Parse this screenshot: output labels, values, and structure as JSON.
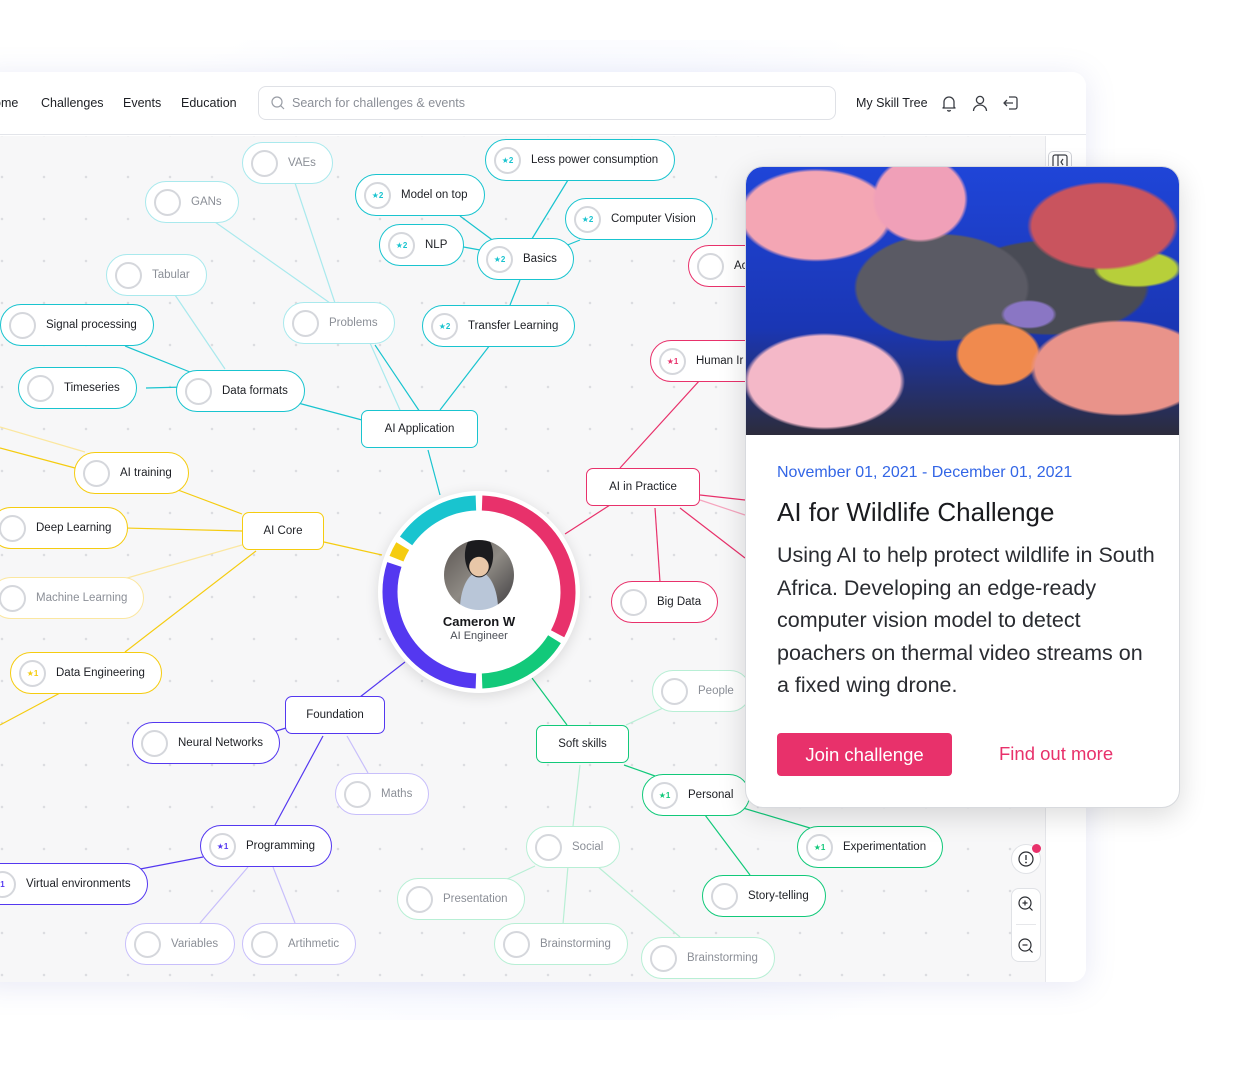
{
  "nav": {
    "items": [
      "ome",
      "Challenges",
      "Events",
      "Education"
    ],
    "search_placeholder": "Search for challenges & events",
    "skill_tree_label": "My Skill Tree",
    "icons": [
      "bell-icon",
      "user-icon",
      "logout-icon"
    ]
  },
  "colors": {
    "cyan": "#19c4cf",
    "pink": "#e8316b",
    "yellow": "#f5cc10",
    "purple": "#5438f0",
    "green": "#12c97a",
    "accent_blue": "#3366e6"
  },
  "profile": {
    "name": "Cameron W",
    "role": "AI Engineer",
    "ring_segments": [
      {
        "category": "AI Application",
        "color": "#19c4cf"
      },
      {
        "category": "AI in Practice",
        "color": "#e8316b"
      },
      {
        "category": "Soft skills",
        "color": "#12c97a"
      },
      {
        "category": "Foundation",
        "color": "#5438f0"
      },
      {
        "category": "AI Core",
        "color": "#f5cc10"
      }
    ]
  },
  "categories": {
    "ai_application": "AI Application",
    "ai_in_practice": "AI in Practice",
    "ai_core": "AI Core",
    "foundation": "Foundation",
    "soft_skills": "Soft skills"
  },
  "skills": {
    "vaes": {
      "label": "VAEs",
      "badge": ""
    },
    "gans": {
      "label": "GANs",
      "badge": ""
    },
    "tabular": {
      "label": "Tabular",
      "badge": ""
    },
    "signal_processing": {
      "label": "Signal processing",
      "badge": ""
    },
    "timeseries": {
      "label": "Timeseries",
      "badge": ""
    },
    "data_formats": {
      "label": "Data formats",
      "badge": ""
    },
    "problems": {
      "label": "Problems",
      "badge": ""
    },
    "less_power": {
      "label": "Less power consumption",
      "badge": "★2"
    },
    "model_on_top": {
      "label": "Model on top",
      "badge": "★2"
    },
    "computer_vision": {
      "label": "Computer Vision",
      "badge": "★2"
    },
    "nlp": {
      "label": "NLP",
      "badge": "★2"
    },
    "basics": {
      "label": "Basics",
      "badge": "★2"
    },
    "transfer_learning": {
      "label": "Transfer Learning",
      "badge": "★2"
    },
    "ac_partial": {
      "label": "Ac",
      "badge": ""
    },
    "human_partial": {
      "label": "Human Ir",
      "badge": "★1"
    },
    "big_data": {
      "label": "Big Data",
      "badge": ""
    },
    "ai_training": {
      "label": "AI training",
      "badge": ""
    },
    "deep_learning": {
      "label": "Deep Learning",
      "badge": ""
    },
    "machine_learning": {
      "label": "Machine Learning",
      "badge": ""
    },
    "data_engineering": {
      "label": "Data Engineering",
      "badge": "★1"
    },
    "neural_networks": {
      "label": "Neural Networks",
      "badge": ""
    },
    "maths": {
      "label": "Maths",
      "badge": ""
    },
    "programming": {
      "label": "Programming",
      "badge": "★1"
    },
    "virtual_env": {
      "label": "Virtual environments",
      "badge": "1"
    },
    "variables": {
      "label": "Variables",
      "badge": ""
    },
    "arithmetic": {
      "label": "Artihmetic",
      "badge": ""
    },
    "people": {
      "label": "People",
      "badge": ""
    },
    "personal": {
      "label": "Personal",
      "badge": "★1"
    },
    "social": {
      "label": "Social",
      "badge": ""
    },
    "presentation": {
      "label": "Presentation",
      "badge": ""
    },
    "brainstorming1": {
      "label": "Brainstorming",
      "badge": ""
    },
    "brainstorming2": {
      "label": "Brainstorming",
      "badge": ""
    },
    "experimentation": {
      "label": "Experimentation",
      "badge": "★1"
    },
    "story_telling": {
      "label": "Story-telling",
      "badge": ""
    }
  },
  "challenge_card": {
    "image_alt": "Colorful coral reef",
    "date_range": "November 01, 2021 - December 01, 2021",
    "title": "AI for Wildlife Challenge",
    "description": "Using AI to help protect wildlife in South Africa. Developing an edge-ready computer vision model to detect poachers on thermal video streams on a fixed wing drone.",
    "join_label": "Join challenge",
    "more_label": "Find out more"
  },
  "controls": {
    "info_has_notification": true,
    "zoom_in": "zoom-in-icon",
    "zoom_out": "zoom-out-icon"
  }
}
